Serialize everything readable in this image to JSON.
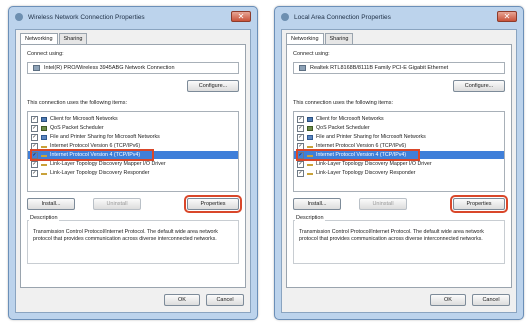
{
  "dialogs": [
    {
      "title": "Wireless Network Connection Properties",
      "tabs": [
        "Networking",
        "Sharing"
      ],
      "connect_using_label": "Connect using:",
      "adapter": "Intel(R) PRO/Wireless 3945ABG Network Connection",
      "configure_label": "Configure...",
      "items_label": "This connection uses the following items:",
      "items": [
        {
          "label": "Client for Microsoft Networks",
          "icon": "client-icon",
          "checked": true
        },
        {
          "label": "QoS Packet Scheduler",
          "icon": "qos-icon",
          "checked": true
        },
        {
          "label": "File and Printer Sharing for Microsoft Networks",
          "icon": "file-sharing-icon",
          "checked": true
        },
        {
          "label": "Internet Protocol Version 6 (TCP/IPv6)",
          "icon": "protocol-icon",
          "checked": true
        },
        {
          "label": "Internet Protocol Version 4 (TCP/IPv4)",
          "icon": "protocol-icon",
          "checked": true,
          "selected": true
        },
        {
          "label": "Link-Layer Topology Discovery Mapper I/O Driver",
          "icon": "protocol-icon",
          "checked": true
        },
        {
          "label": "Link-Layer Topology Discovery Responder",
          "icon": "protocol-icon",
          "checked": true
        }
      ],
      "install_label": "Install...",
      "uninstall_label": "Uninstall",
      "properties_label": "Properties",
      "description_label": "Description",
      "description_text": "Transmission Control Protocol/Internet Protocol. The default wide area network protocol that provides communication across diverse interconnected networks.",
      "ok_label": "OK",
      "cancel_label": "Cancel"
    },
    {
      "title": "Local Area Connection Properties",
      "tabs": [
        "Networking",
        "Sharing"
      ],
      "connect_using_label": "Connect using:",
      "adapter": "Realtek RTL8168B/8111B Family PCI-E Gigabit Ethernet",
      "configure_label": "Configure...",
      "items_label": "This connection uses the following items:",
      "items": [
        {
          "label": "Client for Microsoft Networks",
          "icon": "client-icon",
          "checked": true
        },
        {
          "label": "QoS Packet Scheduler",
          "icon": "qos-icon",
          "checked": true
        },
        {
          "label": "File and Printer Sharing for Microsoft Networks",
          "icon": "file-sharing-icon",
          "checked": true
        },
        {
          "label": "Internet Protocol Version 6 (TCP/IPv6)",
          "icon": "protocol-icon",
          "checked": true
        },
        {
          "label": "Internet Protocol Version 4 (TCP/IPv4)",
          "icon": "protocol-icon",
          "checked": true,
          "selected": true
        },
        {
          "label": "Link-Layer Topology Discovery Mapper I/O Driver",
          "icon": "protocol-icon",
          "checked": true
        },
        {
          "label": "Link-Layer Topology Discovery Responder",
          "icon": "protocol-icon",
          "checked": true
        }
      ],
      "install_label": "Install...",
      "uninstall_label": "Uninstall",
      "properties_label": "Properties",
      "description_label": "Description",
      "description_text": "Transmission Control Protocol/Internet Protocol. The default wide area network protocol that provides communication across diverse interconnected networks.",
      "ok_label": "OK",
      "cancel_label": "Cancel"
    }
  ],
  "colors": {
    "highlight": "#d9472a",
    "selection": "#3f7fd9",
    "title_bar": "#bcd3ec"
  }
}
